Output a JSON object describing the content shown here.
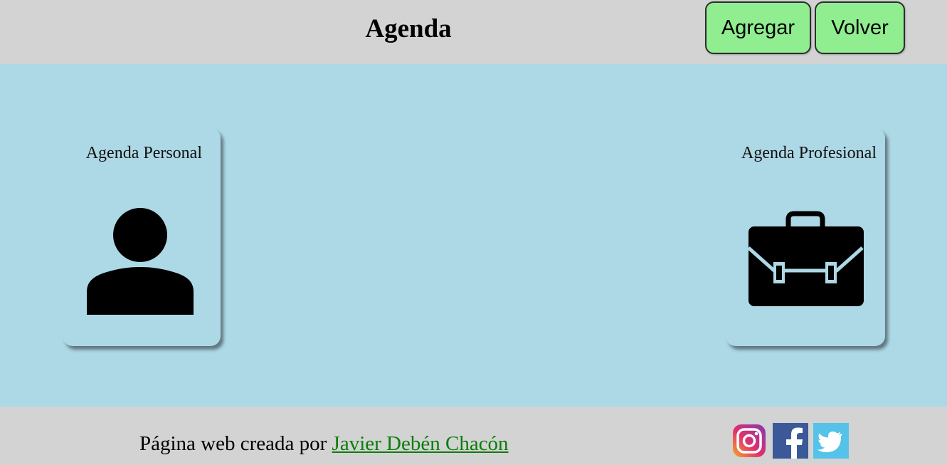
{
  "header": {
    "title": "Agenda",
    "add_label": "Agregar",
    "back_label": "Volver"
  },
  "cards": {
    "personal": {
      "label": "Agenda Personal",
      "icon": "person-icon"
    },
    "professional": {
      "label": "Agenda Profesional",
      "icon": "briefcase-icon"
    }
  },
  "footer": {
    "credit_prefix": "Página web creada por ",
    "author": "Javier Debén Chacón",
    "social": [
      "instagram-icon",
      "facebook-icon",
      "twitter-icon"
    ]
  },
  "colors": {
    "header_bg": "#d3d3d3",
    "main_bg": "#add8e6",
    "button_bg": "#90ee90",
    "link": "#0a7d0a"
  }
}
